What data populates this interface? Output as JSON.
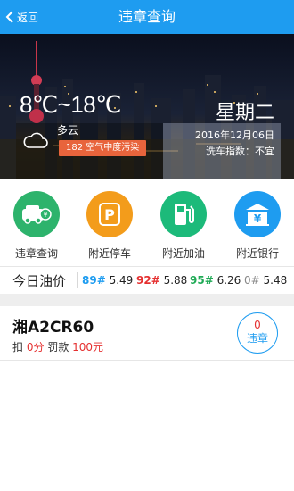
{
  "nav": {
    "back_label": "返回",
    "title": "违章查询"
  },
  "weather": {
    "temperature": "8℃~18℃",
    "condition": "多云",
    "aqi_text": "182 空气中度污染",
    "weekday": "星期二",
    "date": "2016年12月06日",
    "car_wash": "洗车指数：不宜",
    "icon": "cloud-icon"
  },
  "services": [
    {
      "label": "违章查询",
      "icon": "violation-car-icon",
      "color": "#2db36c"
    },
    {
      "label": "附近停车",
      "icon": "parking-icon",
      "color": "#f39c1b"
    },
    {
      "label": "附近加油",
      "icon": "fuel-pump-icon",
      "color": "#1cba7a"
    },
    {
      "label": "附近银行",
      "icon": "bank-icon",
      "color": "#1e9cf0"
    }
  ],
  "oil": {
    "title": "今日油价",
    "prices": [
      {
        "grade": "89#",
        "price": "5.49",
        "color": "#1e9cf0"
      },
      {
        "grade": "92#",
        "price": "5.88",
        "color": "#e53030"
      },
      {
        "grade": "95#",
        "price": "6.26",
        "color": "#1faa55"
      },
      {
        "grade": "0#",
        "price": "5.48",
        "color": "#888888"
      }
    ]
  },
  "car": {
    "plate": "湘A2CR60",
    "deduct_label": "扣",
    "points": "0分",
    "fine_label": "罚款",
    "fine": "100元",
    "violations_count": "0",
    "violations_label": "违章"
  },
  "colors": {
    "primary": "#1e9cf0",
    "alert": "#e53030"
  }
}
